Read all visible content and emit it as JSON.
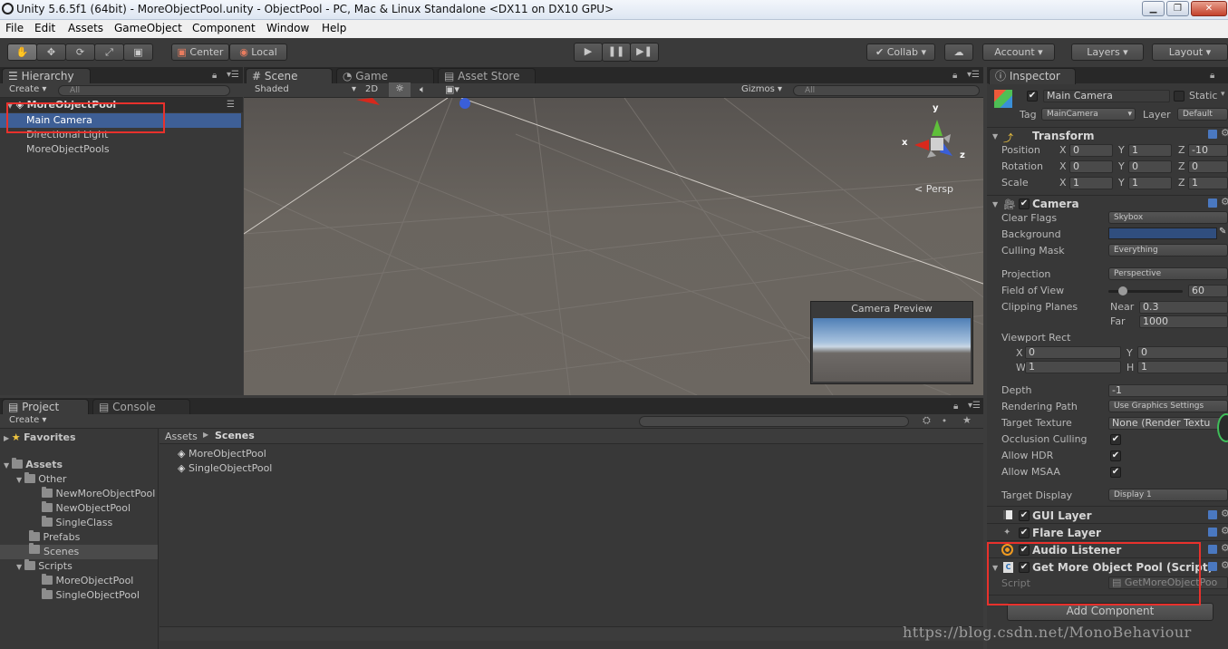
{
  "window": {
    "title": "Unity 5.6.5f1 (64bit) - MoreObjectPool.unity - ObjectPool - PC, Mac & Linux Standalone <DX11 on DX10 GPU>"
  },
  "menu": [
    "File",
    "Edit",
    "Assets",
    "GameObject",
    "Component",
    "Window",
    "Help"
  ],
  "toolbar": {
    "tools": [
      "hand-tool",
      "move-tool",
      "rotate-tool",
      "scale-tool",
      "rect-tool"
    ],
    "pivot": "Center",
    "space": "Local",
    "collab": "Collab",
    "account": "Account",
    "layers": "Layers",
    "layout": "Layout"
  },
  "hierarchy": {
    "tab": "Hierarchy",
    "create": "Create",
    "search_placeholder": "All",
    "scene": "MoreObjectPool",
    "items": [
      "Main Camera",
      "Directional Light",
      "MoreObjectPools"
    ]
  },
  "scene_view": {
    "tabs": [
      "Scene",
      "Game",
      "Asset Store"
    ],
    "shading": "Shaded",
    "mode_2d": "2D",
    "gizmos": "Gizmos",
    "search_placeholder": "All",
    "axis": {
      "x": "x",
      "y": "y",
      "z": "z"
    },
    "persp": "Persp",
    "camera_preview": "Camera Preview"
  },
  "project": {
    "tabs": [
      "Project",
      "Console"
    ],
    "create": "Create",
    "tree": {
      "favorites": "Favorites",
      "assets": "Assets",
      "other": "Other",
      "other_children": [
        "NewMoreObjectPool",
        "NewObjectPool",
        "SingleClass"
      ],
      "prefabs": "Prefabs",
      "scenes": "Scenes",
      "scripts": "Scripts",
      "scripts_children": [
        "MoreObjectPool",
        "SingleObjectPool"
      ]
    },
    "breadcrumb": [
      "Assets",
      "Scenes"
    ],
    "files": [
      "MoreObjectPool",
      "SingleObjectPool"
    ]
  },
  "inspector": {
    "tab": "Inspector",
    "object_name": "Main Camera",
    "static": "Static",
    "tag_label": "Tag",
    "tag_value": "MainCamera",
    "layer_label": "Layer",
    "layer_value": "Default",
    "transform": {
      "title": "Transform",
      "position_label": "Position",
      "position": [
        "0",
        "1",
        "-10"
      ],
      "rotation_label": "Rotation",
      "rotation": [
        "0",
        "0",
        "0"
      ],
      "scale_label": "Scale",
      "scale": [
        "1",
        "1",
        "1"
      ],
      "axes": [
        "X",
        "Y",
        "Z"
      ]
    },
    "camera": {
      "title": "Camera",
      "clear_flags_label": "Clear Flags",
      "clear_flags": "Skybox",
      "background_label": "Background",
      "background_color": "#304e7e",
      "culling_mask_label": "Culling Mask",
      "culling_mask": "Everything",
      "projection_label": "Projection",
      "projection": "Perspective",
      "fov_label": "Field of View",
      "fov": "60",
      "fov_fraction": 0.2,
      "clipping_label": "Clipping Planes",
      "near_label": "Near",
      "near": "0.3",
      "far_label": "Far",
      "far": "1000",
      "viewport_label": "Viewport Rect",
      "vx": "0",
      "vy": "0",
      "vw": "1",
      "vh": "1",
      "depth_label": "Depth",
      "depth": "-1",
      "rendering_path_label": "Rendering Path",
      "rendering_path": "Use Graphics Settings",
      "target_texture_label": "Target Texture",
      "target_texture": "None (Render Textu",
      "occlusion_label": "Occlusion Culling",
      "hdr_label": "Allow HDR",
      "msaa_label": "Allow MSAA",
      "target_display_label": "Target Display",
      "target_display": "Display 1"
    },
    "components": [
      "GUI Layer",
      "Flare Layer",
      "Audio Listener",
      "Get More Object Pool (Script)"
    ],
    "script_label": "Script",
    "script_value": "GetMoreObjectPoo",
    "add_component": "Add Component"
  },
  "watermark": "https://blog.csdn.net/MonoBehaviour"
}
